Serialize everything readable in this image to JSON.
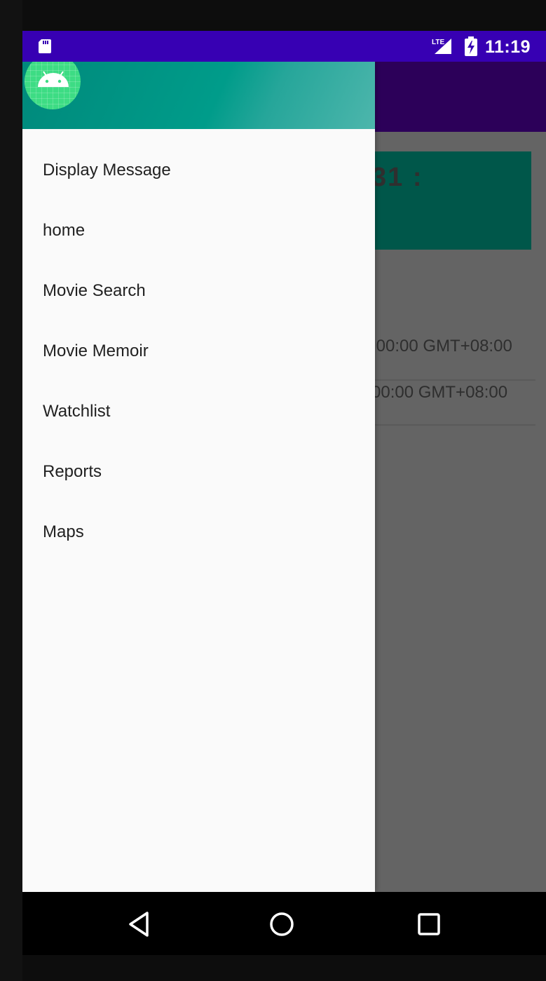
{
  "status_bar": {
    "time": "11:19",
    "left_icon": "sd-card-icon",
    "network_icon": "lte-signal-icon",
    "battery_icon": "battery-charging-icon"
  },
  "background_content": {
    "card_title": "31 :",
    "rows": [
      ":00:00 GMT+08:00",
      "00:00 GMT+08:00"
    ]
  },
  "drawer": {
    "header_icon": "android-icon",
    "items": [
      {
        "label": "Display Message"
      },
      {
        "label": "home"
      },
      {
        "label": "Movie Search"
      },
      {
        "label": "Movie Memoir"
      },
      {
        "label": "Watchlist"
      },
      {
        "label": "Reports"
      },
      {
        "label": "Maps"
      }
    ]
  },
  "nav_bar": {
    "buttons": [
      "back-icon",
      "home-icon",
      "recents-icon"
    ]
  },
  "colors": {
    "status_bar": "#3700B3",
    "drawer_header": "#009688",
    "card": "#00574a",
    "avatar": "#3ddc84"
  }
}
